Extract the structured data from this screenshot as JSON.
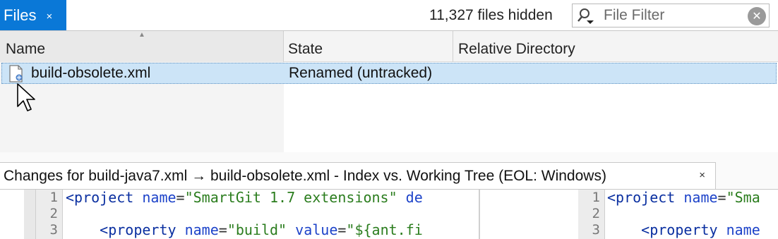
{
  "files_panel": {
    "tab_label": "Files",
    "tab_close": "×",
    "hidden_count": "11,327 files hidden",
    "filter": {
      "placeholder": "File Filter",
      "value": ""
    },
    "columns": [
      "Name",
      "State",
      "Relative Directory"
    ],
    "rows": [
      {
        "name": "build-obsolete.xml",
        "state": "Renamed (untracked)",
        "directory": ""
      }
    ]
  },
  "changes_panel": {
    "tab_label": "Changes for build-java7.xml → build-obsolete.xml - Index vs. Working Tree (EOL: Windows)",
    "tab_close": "×",
    "left": {
      "line_numbers": [
        "1",
        "2",
        "3"
      ],
      "line1": {
        "open": "<project",
        "attr": "name",
        "eq": "=",
        "str": "\"SmartGit 1.7 extensions\"",
        "attr2": "de"
      },
      "line3": {
        "open": "<property",
        "attr": "name",
        "eq": "=",
        "str": "\"build\"",
        "attr2": "value",
        "eq2": "=",
        "str2": "\"${ant.fi"
      }
    },
    "right": {
      "line_numbers": [
        "1",
        "2",
        "3"
      ],
      "line1": {
        "open": "<project",
        "attr": "name",
        "eq": "=",
        "str": "\"Sma"
      },
      "line3": {
        "open": "<property",
        "attr": "name"
      }
    }
  },
  "colors": {
    "tab_active": "#0a78d7",
    "selection": "#cce4f7",
    "keyword": "#0a2fa0",
    "string": "#2b7d1e"
  },
  "icons": [
    "close-icon",
    "search-icon",
    "clear-icon",
    "xml-file-icon",
    "mouse-cursor-icon"
  ]
}
